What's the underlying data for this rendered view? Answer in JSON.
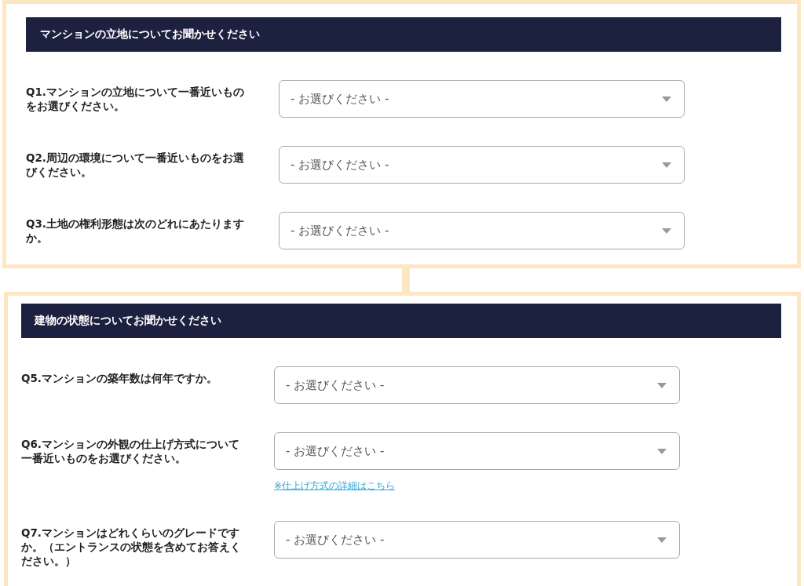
{
  "sections": [
    {
      "title": "マンションの立地についてお聞かせください",
      "questions": [
        {
          "label": "Q1.マンションの立地について一番近いものをお選びください。",
          "placeholder": "- お選びください -"
        },
        {
          "label": "Q2.周辺の環境について一番近いものをお選びください。",
          "placeholder": "- お選びください -"
        },
        {
          "label": "Q3.土地の権利形態は次のどれにあたりますか。",
          "placeholder": "- お選びください -"
        }
      ]
    },
    {
      "title": "建物の状態についてお聞かせください",
      "questions": [
        {
          "label": "Q5.マンションの築年数は何年ですか。",
          "placeholder": "- お選びください -"
        },
        {
          "label": "Q6.マンションの外観の仕上げ方式について一番近いものをお選びください。",
          "placeholder": "- お選びください -",
          "link": "※仕上げ方式の詳細はこちら"
        },
        {
          "label": "Q7.マンションはどれくらいのグレードですか。（エントランスの状態を含めてお答えください。）",
          "placeholder": "- お選びください -"
        }
      ]
    }
  ]
}
